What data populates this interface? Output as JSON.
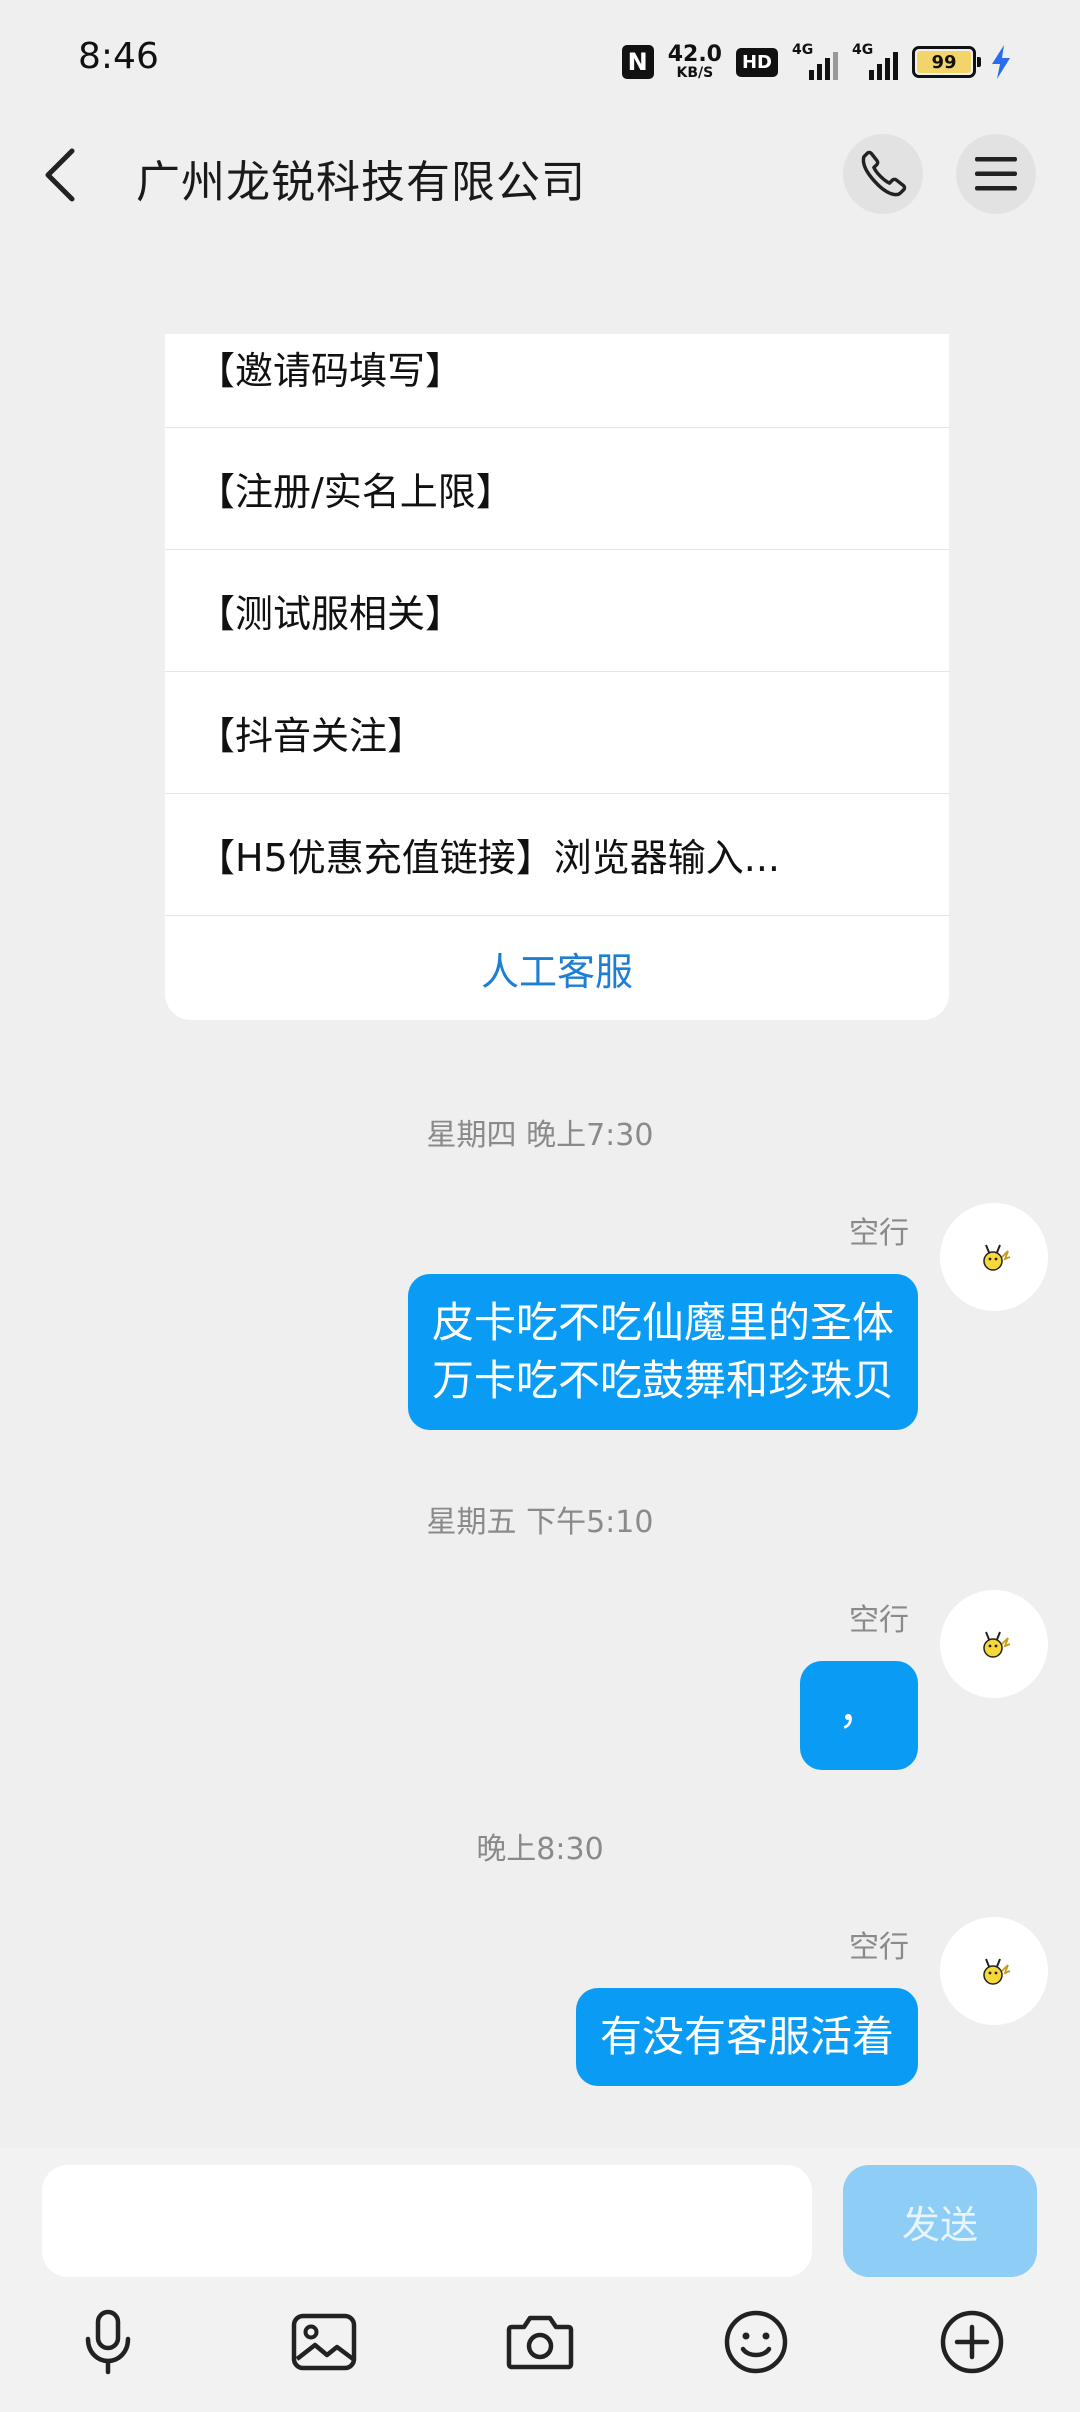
{
  "status_bar": {
    "time": "8:46",
    "nfc_label": "N",
    "net_speed_value": "42.0",
    "net_speed_unit": "KB/S",
    "hd_label": "HD",
    "sim1_label": "4G",
    "sim2_label": "4G",
    "battery_level": "99",
    "charging": true
  },
  "header": {
    "title": "广州龙锐科技有限公司",
    "back_icon": "chevron-left-icon",
    "call_icon": "phone-icon",
    "menu_icon": "hamburger-menu-icon"
  },
  "menu_card": {
    "items": [
      "【邀请码填写】",
      "【注册/实名上限】",
      "【测试服相关】",
      "【抖音关注】",
      "【H5优惠充值链接】浏览器输入..."
    ],
    "human_service_label": "人工客服"
  },
  "messages": [
    {
      "timestamp": "星期四 晚上7:30",
      "sender": "空行",
      "text": "皮卡吃不吃仙魔里的圣体\n万卡吃不吃鼓舞和珍珠贝"
    },
    {
      "timestamp": "星期五 下午5:10",
      "sender": "空行",
      "text": "，"
    },
    {
      "timestamp": "晚上8:30",
      "sender": "空行",
      "text": "有没有客服活着"
    }
  ],
  "input_bar": {
    "placeholder": "",
    "send_label": "发送",
    "tools": [
      "microphone-icon",
      "image-icon",
      "camera-icon",
      "emoji-icon",
      "plus-icon"
    ]
  },
  "colors": {
    "bubble": "#0a9cf5",
    "link": "#1e7ed4",
    "send_disabled": "#8dcdf6",
    "background": "#efefef"
  }
}
